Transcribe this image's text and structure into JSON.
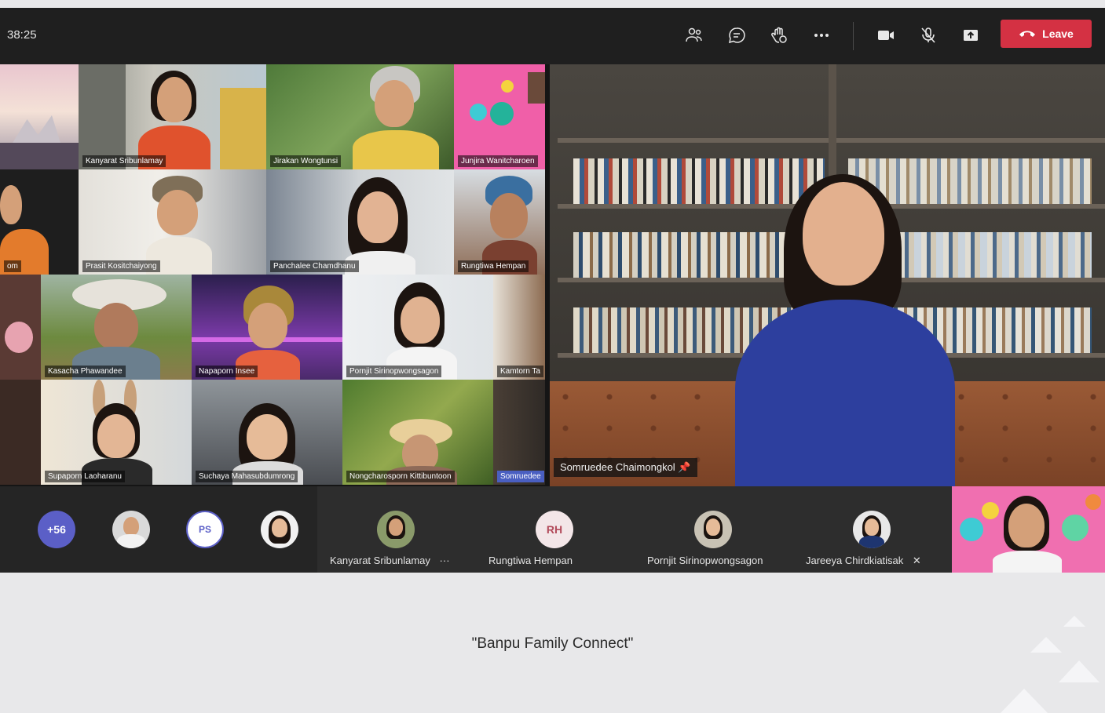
{
  "meeting": {
    "timer": "38:25"
  },
  "toolbar": {
    "people_icon": "people-icon",
    "chat_icon": "chat-icon",
    "reactions_icon": "raise-hand-icon",
    "more_icon": "more-icon",
    "camera_icon": "camera-icon",
    "mic_icon": "mic-muted-icon",
    "share_icon": "share-icon",
    "leave_label": "Leave",
    "leave_color": "#d43143"
  },
  "gallery": [
    {
      "name": ""
    },
    {
      "name": "Kanyarat Sribunlamay"
    },
    {
      "name": "Jirakan Wongtunsi"
    },
    {
      "name": "Junjira Wanitcharoen"
    },
    {
      "name": "om"
    },
    {
      "name": "Prasit Kositchaiyong"
    },
    {
      "name": "Panchalee Chamdhanu"
    },
    {
      "name": "Rungtiwa Hempan"
    },
    {
      "name": ""
    },
    {
      "name": "Kasacha Phawandee"
    },
    {
      "name": "Napaporn Insee"
    },
    {
      "name": "Pornjit Sirinopwongsagon"
    },
    {
      "name": "Kamtorn Ta"
    },
    {
      "name": ""
    },
    {
      "name": "Supaporn Laoharanu"
    },
    {
      "name": "Suchaya Mahasubdumrong"
    },
    {
      "name": "Nongcharosporn Kittibuntoon"
    },
    {
      "name": "Somruedee"
    }
  ],
  "main_speaker": {
    "name": "Somruedee Chaimongkol"
  },
  "participants_bar": {
    "overflow_count": "+56",
    "initials_avatar": "PS",
    "tiles": [
      {
        "name": "Kanyarat Sribunlamay",
        "extra": "···"
      },
      {
        "name": "Rungtiwa Hempan",
        "initials": "RH"
      },
      {
        "name": "Pornjit Sirinopwongsagon"
      },
      {
        "name": "Jareeya Chirdkiatisak"
      }
    ]
  },
  "caption": "\"Banpu Family Connect\""
}
